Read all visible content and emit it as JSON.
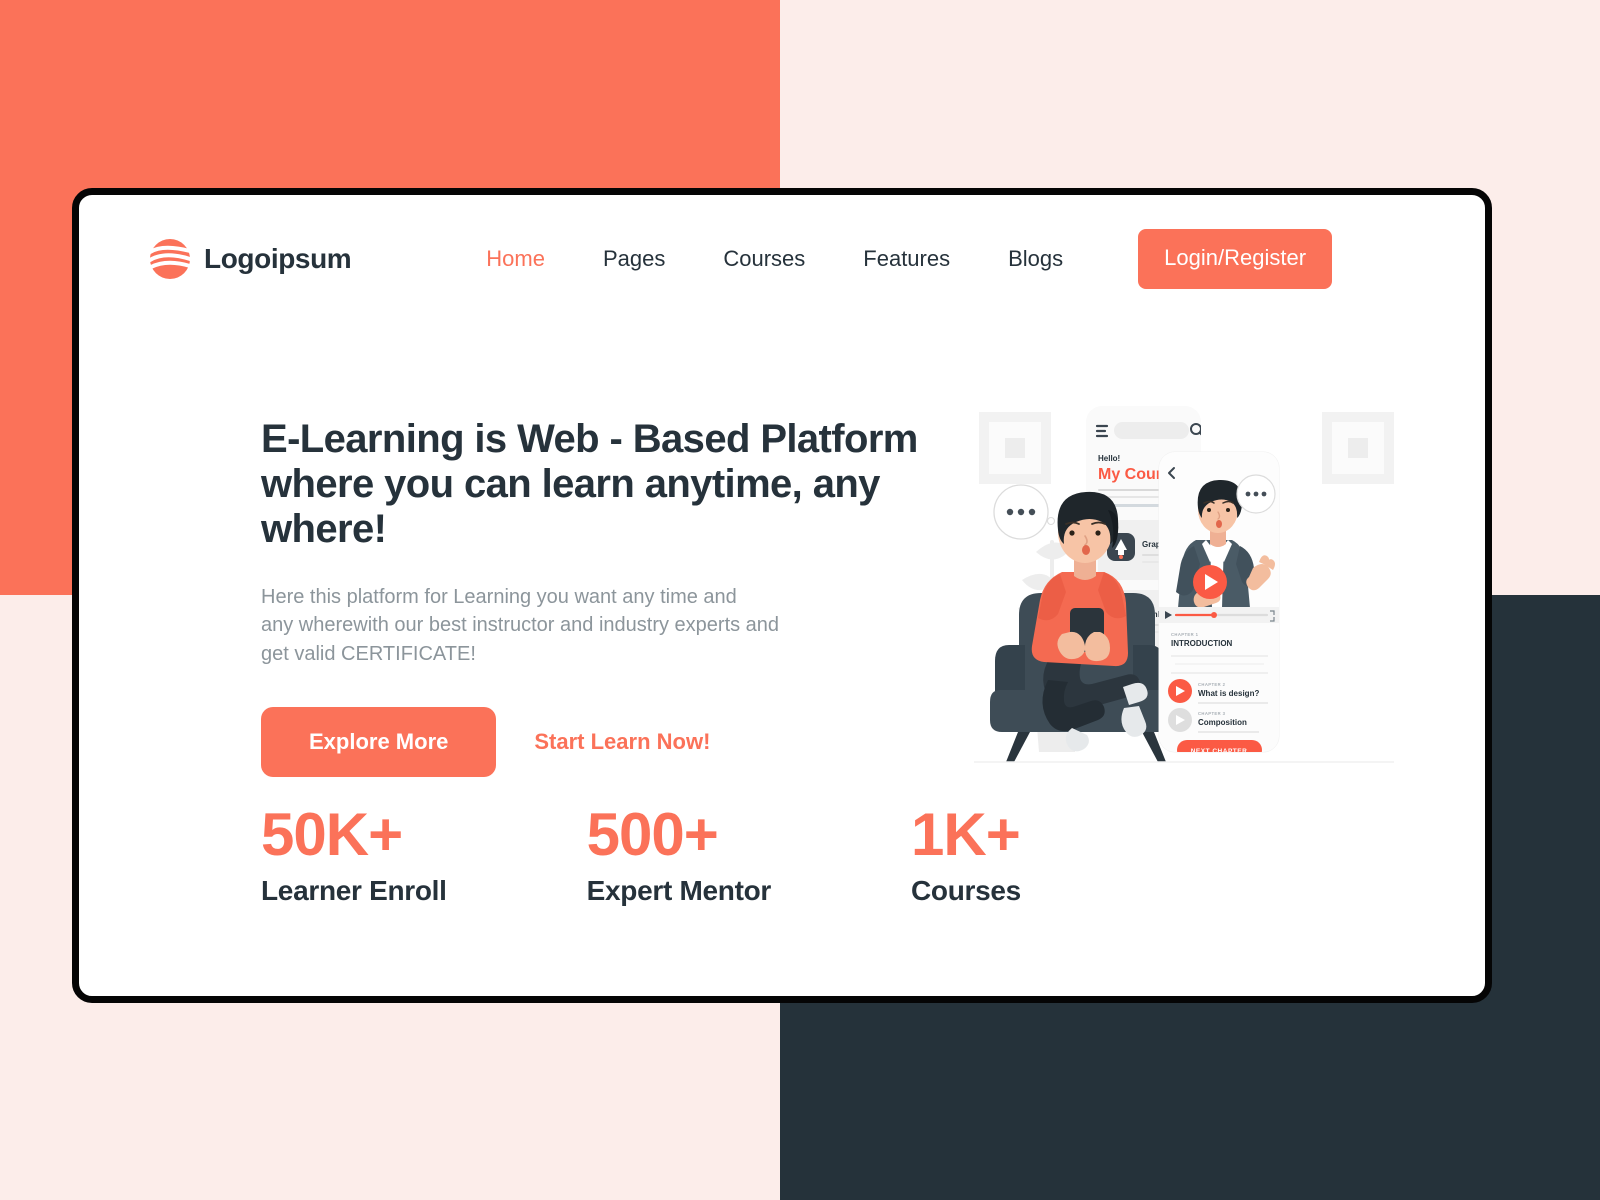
{
  "page": {
    "background_color": "#FCEDEA",
    "accent_color": "#FB7259",
    "dark_color": "#25323A",
    "text_color": "#26323B",
    "muted_text_color": "#8C959B"
  },
  "header": {
    "brand_name": "Logoipsum",
    "nav_items": [
      {
        "label": "Home",
        "active": true
      },
      {
        "label": "Pages",
        "active": false
      },
      {
        "label": "Courses",
        "active": false
      },
      {
        "label": "Features",
        "active": false
      },
      {
        "label": "Blogs",
        "active": false
      }
    ],
    "login_button": "Login/Register"
  },
  "hero": {
    "headline": "E-Learning is Web - Based  Platform\nwhere you can learn anytime, any where!",
    "subtext": "Here this platform for Learning you want any time and\nany wherewith our best instructor and industry experts and\nget valid  CERTIFICATE!",
    "primary_cta": "Explore More",
    "secondary_cta": "Start Learn Now!"
  },
  "stats": [
    {
      "value": "50K+",
      "label": "Learner Enroll"
    },
    {
      "value": "500+",
      "label": "Expert Mentor"
    },
    {
      "value": "1K+",
      "label": "Courses"
    }
  ],
  "illustration": {
    "back_phone": {
      "greeting": "Hello!",
      "title": "My Courses",
      "item_one": "Grap",
      "item_two": "Html"
    },
    "front_phone": {
      "chapter_one_eyebrow": "CHAPTER 1",
      "chapter_one_title": "INTRODUCTION",
      "chapter_two_eyebrow": "CHAPTER 2",
      "chapter_two_title": "What is design?",
      "chapter_three_eyebrow": "CHAPTER 3",
      "chapter_three_title": "Composition",
      "next_button": "NEXT CHAPTER"
    }
  }
}
